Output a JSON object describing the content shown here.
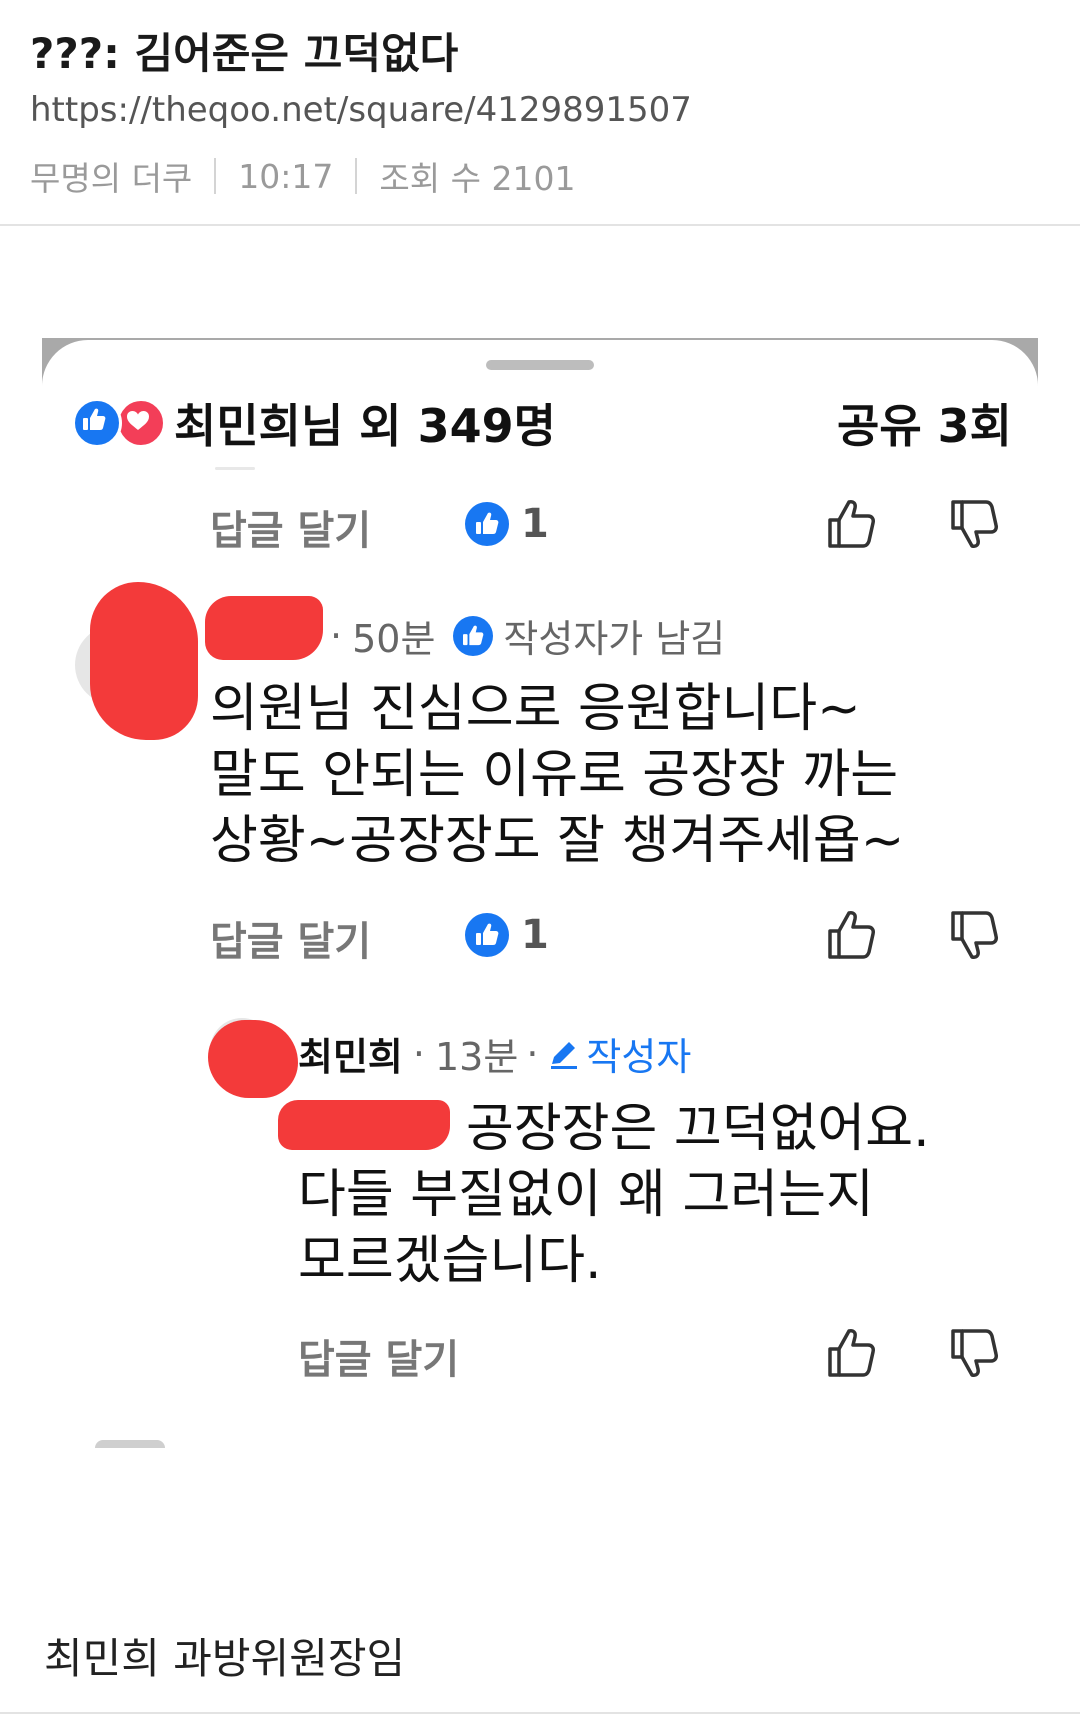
{
  "post": {
    "title": "???: 김어준은 끄덕없다",
    "url": "https://theqoo.net/square/4129891507",
    "author": "무명의 더쿠",
    "time": "10:17",
    "views": "조회 수 2101"
  },
  "colors": {
    "facebook_blue": "#1877f2",
    "love_red": "#f33e58",
    "redaction": "#f33a3a"
  },
  "screenshot": {
    "reactions": {
      "icons": [
        "like-icon",
        "love-icon"
      ],
      "summary": "최민희님 외 349명",
      "shares": "공유 3회"
    },
    "comments": [
      {
        "reply_label": "답글 달기",
        "like_count": "1"
      },
      {
        "time": "50분",
        "badge": "작성자가 남김",
        "lines": [
          "의원님 진심으로 응원합니다~",
          "말도 안되는 이유로 공장장 까는",
          "상황~공장장도 잘 챙겨주세욥~"
        ],
        "reply_label": "답글 달기",
        "like_count": "1"
      },
      {
        "name": "최민희",
        "time": "13분",
        "author_tag": "작성자",
        "lines": [
          "공장장은 끄덕없어요.",
          "다들 부질없이 왜 그러는지",
          "모르겠습니다."
        ],
        "reply_label": "답글 달기"
      }
    ]
  },
  "caption": "최민희 과방위원장임"
}
